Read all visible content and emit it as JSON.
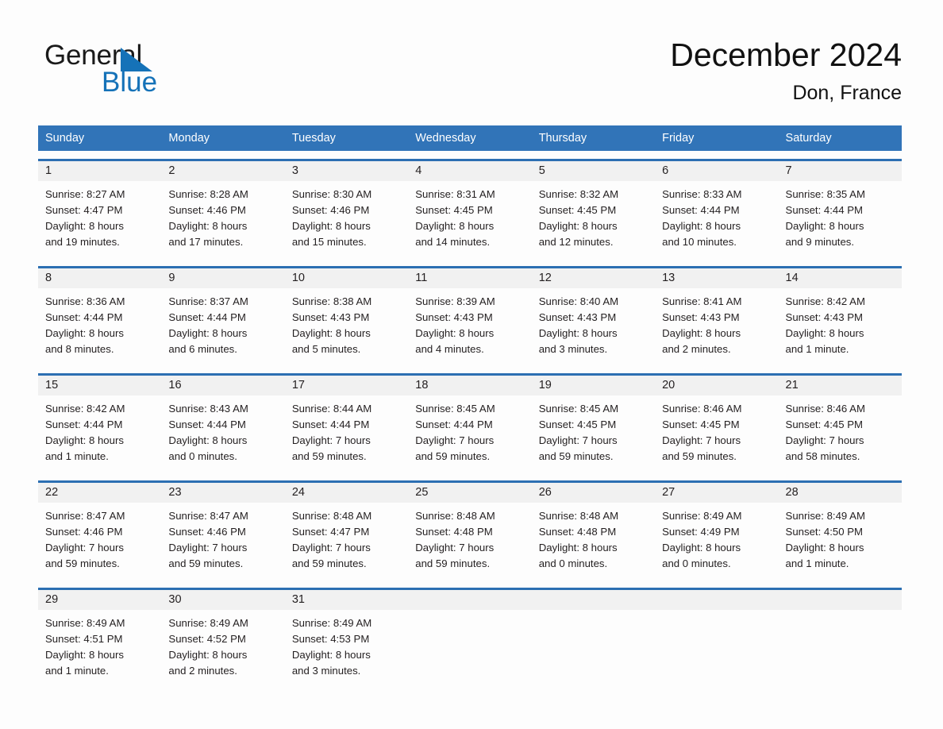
{
  "brand": {
    "name_part1": "General",
    "name_part2": "Blue"
  },
  "header": {
    "title": "December 2024",
    "subtitle": "Don, France"
  },
  "colors": {
    "header_blue": "#3174b8",
    "row_divider_blue": "#2c6fb2",
    "daynum_band": "#f1f1f1",
    "logo_blue": "#1572b8",
    "text": "#231f20"
  },
  "weekdays": [
    "Sunday",
    "Monday",
    "Tuesday",
    "Wednesday",
    "Thursday",
    "Friday",
    "Saturday"
  ],
  "weeks": [
    [
      {
        "day": "1",
        "sunrise": "Sunrise: 8:27 AM",
        "sunset": "Sunset: 4:47 PM",
        "daylight1": "Daylight: 8 hours",
        "daylight2": "and 19 minutes."
      },
      {
        "day": "2",
        "sunrise": "Sunrise: 8:28 AM",
        "sunset": "Sunset: 4:46 PM",
        "daylight1": "Daylight: 8 hours",
        "daylight2": "and 17 minutes."
      },
      {
        "day": "3",
        "sunrise": "Sunrise: 8:30 AM",
        "sunset": "Sunset: 4:46 PM",
        "daylight1": "Daylight: 8 hours",
        "daylight2": "and 15 minutes."
      },
      {
        "day": "4",
        "sunrise": "Sunrise: 8:31 AM",
        "sunset": "Sunset: 4:45 PM",
        "daylight1": "Daylight: 8 hours",
        "daylight2": "and 14 minutes."
      },
      {
        "day": "5",
        "sunrise": "Sunrise: 8:32 AM",
        "sunset": "Sunset: 4:45 PM",
        "daylight1": "Daylight: 8 hours",
        "daylight2": "and 12 minutes."
      },
      {
        "day": "6",
        "sunrise": "Sunrise: 8:33 AM",
        "sunset": "Sunset: 4:44 PM",
        "daylight1": "Daylight: 8 hours",
        "daylight2": "and 10 minutes."
      },
      {
        "day": "7",
        "sunrise": "Sunrise: 8:35 AM",
        "sunset": "Sunset: 4:44 PM",
        "daylight1": "Daylight: 8 hours",
        "daylight2": "and 9 minutes."
      }
    ],
    [
      {
        "day": "8",
        "sunrise": "Sunrise: 8:36 AM",
        "sunset": "Sunset: 4:44 PM",
        "daylight1": "Daylight: 8 hours",
        "daylight2": "and 8 minutes."
      },
      {
        "day": "9",
        "sunrise": "Sunrise: 8:37 AM",
        "sunset": "Sunset: 4:44 PM",
        "daylight1": "Daylight: 8 hours",
        "daylight2": "and 6 minutes."
      },
      {
        "day": "10",
        "sunrise": "Sunrise: 8:38 AM",
        "sunset": "Sunset: 4:43 PM",
        "daylight1": "Daylight: 8 hours",
        "daylight2": "and 5 minutes."
      },
      {
        "day": "11",
        "sunrise": "Sunrise: 8:39 AM",
        "sunset": "Sunset: 4:43 PM",
        "daylight1": "Daylight: 8 hours",
        "daylight2": "and 4 minutes."
      },
      {
        "day": "12",
        "sunrise": "Sunrise: 8:40 AM",
        "sunset": "Sunset: 4:43 PM",
        "daylight1": "Daylight: 8 hours",
        "daylight2": "and 3 minutes."
      },
      {
        "day": "13",
        "sunrise": "Sunrise: 8:41 AM",
        "sunset": "Sunset: 4:43 PM",
        "daylight1": "Daylight: 8 hours",
        "daylight2": "and 2 minutes."
      },
      {
        "day": "14",
        "sunrise": "Sunrise: 8:42 AM",
        "sunset": "Sunset: 4:43 PM",
        "daylight1": "Daylight: 8 hours",
        "daylight2": "and 1 minute."
      }
    ],
    [
      {
        "day": "15",
        "sunrise": "Sunrise: 8:42 AM",
        "sunset": "Sunset: 4:44 PM",
        "daylight1": "Daylight: 8 hours",
        "daylight2": "and 1 minute."
      },
      {
        "day": "16",
        "sunrise": "Sunrise: 8:43 AM",
        "sunset": "Sunset: 4:44 PM",
        "daylight1": "Daylight: 8 hours",
        "daylight2": "and 0 minutes."
      },
      {
        "day": "17",
        "sunrise": "Sunrise: 8:44 AM",
        "sunset": "Sunset: 4:44 PM",
        "daylight1": "Daylight: 7 hours",
        "daylight2": "and 59 minutes."
      },
      {
        "day": "18",
        "sunrise": "Sunrise: 8:45 AM",
        "sunset": "Sunset: 4:44 PM",
        "daylight1": "Daylight: 7 hours",
        "daylight2": "and 59 minutes."
      },
      {
        "day": "19",
        "sunrise": "Sunrise: 8:45 AM",
        "sunset": "Sunset: 4:45 PM",
        "daylight1": "Daylight: 7 hours",
        "daylight2": "and 59 minutes."
      },
      {
        "day": "20",
        "sunrise": "Sunrise: 8:46 AM",
        "sunset": "Sunset: 4:45 PM",
        "daylight1": "Daylight: 7 hours",
        "daylight2": "and 59 minutes."
      },
      {
        "day": "21",
        "sunrise": "Sunrise: 8:46 AM",
        "sunset": "Sunset: 4:45 PM",
        "daylight1": "Daylight: 7 hours",
        "daylight2": "and 58 minutes."
      }
    ],
    [
      {
        "day": "22",
        "sunrise": "Sunrise: 8:47 AM",
        "sunset": "Sunset: 4:46 PM",
        "daylight1": "Daylight: 7 hours",
        "daylight2": "and 59 minutes."
      },
      {
        "day": "23",
        "sunrise": "Sunrise: 8:47 AM",
        "sunset": "Sunset: 4:46 PM",
        "daylight1": "Daylight: 7 hours",
        "daylight2": "and 59 minutes."
      },
      {
        "day": "24",
        "sunrise": "Sunrise: 8:48 AM",
        "sunset": "Sunset: 4:47 PM",
        "daylight1": "Daylight: 7 hours",
        "daylight2": "and 59 minutes."
      },
      {
        "day": "25",
        "sunrise": "Sunrise: 8:48 AM",
        "sunset": "Sunset: 4:48 PM",
        "daylight1": "Daylight: 7 hours",
        "daylight2": "and 59 minutes."
      },
      {
        "day": "26",
        "sunrise": "Sunrise: 8:48 AM",
        "sunset": "Sunset: 4:48 PM",
        "daylight1": "Daylight: 8 hours",
        "daylight2": "and 0 minutes."
      },
      {
        "day": "27",
        "sunrise": "Sunrise: 8:49 AM",
        "sunset": "Sunset: 4:49 PM",
        "daylight1": "Daylight: 8 hours",
        "daylight2": "and 0 minutes."
      },
      {
        "day": "28",
        "sunrise": "Sunrise: 8:49 AM",
        "sunset": "Sunset: 4:50 PM",
        "daylight1": "Daylight: 8 hours",
        "daylight2": "and 1 minute."
      }
    ],
    [
      {
        "day": "29",
        "sunrise": "Sunrise: 8:49 AM",
        "sunset": "Sunset: 4:51 PM",
        "daylight1": "Daylight: 8 hours",
        "daylight2": "and 1 minute."
      },
      {
        "day": "30",
        "sunrise": "Sunrise: 8:49 AM",
        "sunset": "Sunset: 4:52 PM",
        "daylight1": "Daylight: 8 hours",
        "daylight2": "and 2 minutes."
      },
      {
        "day": "31",
        "sunrise": "Sunrise: 8:49 AM",
        "sunset": "Sunset: 4:53 PM",
        "daylight1": "Daylight: 8 hours",
        "daylight2": "and 3 minutes."
      },
      {
        "day": "",
        "sunrise": "",
        "sunset": "",
        "daylight1": "",
        "daylight2": ""
      },
      {
        "day": "",
        "sunrise": "",
        "sunset": "",
        "daylight1": "",
        "daylight2": ""
      },
      {
        "day": "",
        "sunrise": "",
        "sunset": "",
        "daylight1": "",
        "daylight2": ""
      },
      {
        "day": "",
        "sunrise": "",
        "sunset": "",
        "daylight1": "",
        "daylight2": ""
      }
    ]
  ]
}
